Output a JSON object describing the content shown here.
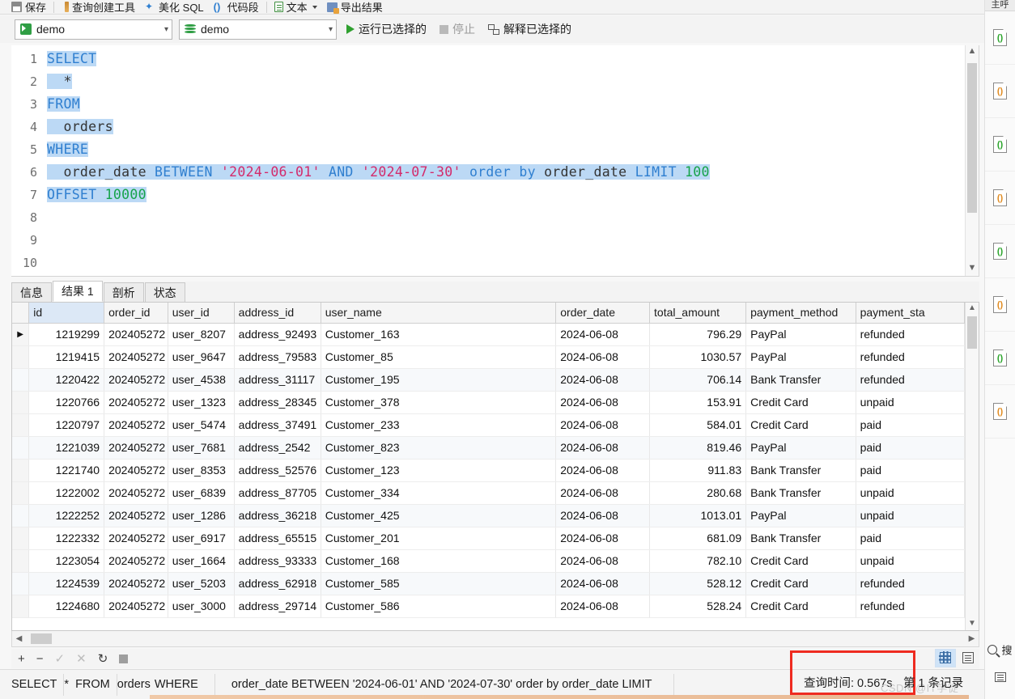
{
  "toolbar": {
    "items": [
      {
        "label": "保存",
        "icon": "save-icon"
      },
      {
        "label": "查询创建工具",
        "icon": "query-builder-icon"
      },
      {
        "label": "美化 SQL",
        "icon": "beautify-icon"
      },
      {
        "label": "代码段",
        "icon": "snippet-icon"
      },
      {
        "label": "文本",
        "icon": "text-icon"
      },
      {
        "label": "导出结果",
        "icon": "export-icon"
      }
    ]
  },
  "connbar": {
    "connection": "demo",
    "database": "demo",
    "run_selected": "运行已选择的",
    "stop": "停止",
    "explain_selected": "解释已选择的"
  },
  "editor": {
    "line_numbers": [
      "1",
      "2",
      "3",
      "4",
      "5",
      "6",
      "7",
      "8",
      "9",
      "10"
    ],
    "tokens": {
      "select": "SELECT",
      "star": "*",
      "from": "FROM",
      "table": "orders",
      "where": "WHERE",
      "col_order_date": "order_date",
      "between": "BETWEEN",
      "date_from": "'2024-06-01'",
      "and": "AND",
      "date_to": "'2024-07-30'",
      "order_by": "order by",
      "order_by_col": "order_date",
      "limit": "LIMIT",
      "limit_value": "100",
      "offset": "OFFSET",
      "offset_value": "10000"
    }
  },
  "result_tabs": [
    {
      "label": "信息",
      "active": false
    },
    {
      "label": "结果 1",
      "active": true
    },
    {
      "label": "剖析",
      "active": false
    },
    {
      "label": "状态",
      "active": false
    }
  ],
  "grid": {
    "columns": [
      "id",
      "order_id",
      "user_id",
      "address_id",
      "user_name",
      "order_date",
      "total_amount",
      "payment_method",
      "payment_sta"
    ],
    "rows": [
      {
        "marker": "▶",
        "id": "1219299",
        "order_id": "202405272",
        "user_id": "user_8207",
        "address_id": "address_92493",
        "user_name": "Customer_163",
        "order_date": "2024-06-08",
        "total_amount": "796.29",
        "payment_method": "PayPal",
        "payment_status": "refunded"
      },
      {
        "marker": "",
        "id": "1219415",
        "order_id": "202405272",
        "user_id": "user_9647",
        "address_id": "address_79583",
        "user_name": "Customer_85",
        "order_date": "2024-06-08",
        "total_amount": "1030.57",
        "payment_method": "PayPal",
        "payment_status": "refunded"
      },
      {
        "marker": "",
        "id": "1220422",
        "order_id": "202405272",
        "user_id": "user_4538",
        "address_id": "address_31117",
        "user_name": "Customer_195",
        "order_date": "2024-06-08",
        "total_amount": "706.14",
        "payment_method": "Bank Transfer",
        "payment_status": "refunded"
      },
      {
        "marker": "",
        "id": "1220766",
        "order_id": "202405272",
        "user_id": "user_1323",
        "address_id": "address_28345",
        "user_name": "Customer_378",
        "order_date": "2024-06-08",
        "total_amount": "153.91",
        "payment_method": "Credit Card",
        "payment_status": "unpaid"
      },
      {
        "marker": "",
        "id": "1220797",
        "order_id": "202405272",
        "user_id": "user_5474",
        "address_id": "address_37491",
        "user_name": "Customer_233",
        "order_date": "2024-06-08",
        "total_amount": "584.01",
        "payment_method": "Credit Card",
        "payment_status": "paid"
      },
      {
        "marker": "",
        "id": "1221039",
        "order_id": "202405272",
        "user_id": "user_7681",
        "address_id": "address_2542",
        "user_name": "Customer_823",
        "order_date": "2024-06-08",
        "total_amount": "819.46",
        "payment_method": "PayPal",
        "payment_status": "paid"
      },
      {
        "marker": "",
        "id": "1221740",
        "order_id": "202405272",
        "user_id": "user_8353",
        "address_id": "address_52576",
        "user_name": "Customer_123",
        "order_date": "2024-06-08",
        "total_amount": "911.83",
        "payment_method": "Bank Transfer",
        "payment_status": "paid"
      },
      {
        "marker": "",
        "id": "1222002",
        "order_id": "202405272",
        "user_id": "user_6839",
        "address_id": "address_87705",
        "user_name": "Customer_334",
        "order_date": "2024-06-08",
        "total_amount": "280.68",
        "payment_method": "Bank Transfer",
        "payment_status": "unpaid"
      },
      {
        "marker": "",
        "id": "1222252",
        "order_id": "202405272",
        "user_id": "user_1286",
        "address_id": "address_36218",
        "user_name": "Customer_425",
        "order_date": "2024-06-08",
        "total_amount": "1013.01",
        "payment_method": "PayPal",
        "payment_status": "unpaid"
      },
      {
        "marker": "",
        "id": "1222332",
        "order_id": "202405272",
        "user_id": "user_6917",
        "address_id": "address_65515",
        "user_name": "Customer_201",
        "order_date": "2024-06-08",
        "total_amount": "681.09",
        "payment_method": "Bank Transfer",
        "payment_status": "paid"
      },
      {
        "marker": "",
        "id": "1223054",
        "order_id": "202405272",
        "user_id": "user_1664",
        "address_id": "address_93333",
        "user_name": "Customer_168",
        "order_date": "2024-06-08",
        "total_amount": "782.10",
        "payment_method": "Credit Card",
        "payment_status": "unpaid"
      },
      {
        "marker": "",
        "id": "1224539",
        "order_id": "202405272",
        "user_id": "user_5203",
        "address_id": "address_62918",
        "user_name": "Customer_585",
        "order_date": "2024-06-08",
        "total_amount": "528.12",
        "payment_method": "Credit Card",
        "payment_status": "refunded"
      },
      {
        "marker": "",
        "id": "1224680",
        "order_id": "202405272",
        "user_id": "user_3000",
        "address_id": "address_29714",
        "user_name": "Customer_586",
        "order_date": "2024-06-08",
        "total_amount": "528.24",
        "payment_method": "Credit Card",
        "payment_status": "refunded"
      }
    ]
  },
  "edit_row": {
    "add": "+",
    "remove": "−",
    "confirm": "✓",
    "cancel": "✕",
    "refresh": "↻",
    "stop": "stop-icon"
  },
  "statusbar": {
    "sql_parts": [
      "SELECT",
      "*",
      "FROM",
      "orders",
      "WHERE",
      "order_date BETWEEN '2024-06-01' AND '2024-07-30' order by order_date LIMIT"
    ],
    "query_time": "查询时间: 0.567s",
    "records": "第 1 条记录",
    "watermark": "CSDN @IT学徒"
  },
  "rail": {
    "top_label": "主呼",
    "file_icons": [
      "code-file-icon",
      "code-file-icon",
      "code-file-icon",
      "code-file-icon",
      "code-file-icon",
      "code-file-icon",
      "code-file-icon",
      "code-file-icon"
    ],
    "search_label": "搜",
    "bottom_icons": [
      "search-icon",
      "list-icon"
    ]
  },
  "colors": {
    "accent_blue": "#2f7fd0",
    "string_pink": "#d42a6b",
    "number_green": "#16a34a",
    "selection": "#bcd9f5",
    "highlight_red": "#ee2b20",
    "run_green": "#2fa02f"
  }
}
